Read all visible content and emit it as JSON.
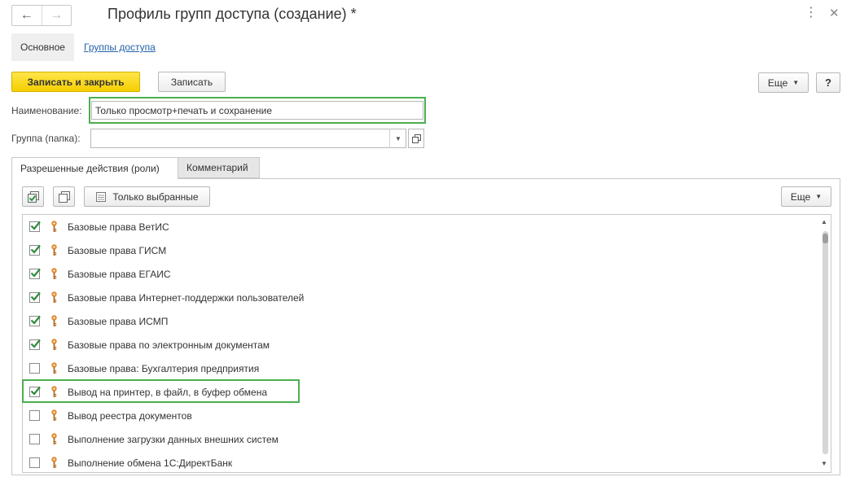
{
  "window": {
    "title": "Профиль групп доступа (создание) *"
  },
  "section_tabs": [
    {
      "label": "Основное"
    },
    {
      "label": "Группы доступа"
    }
  ],
  "toolbar": {
    "save_close_label": "Записать и закрыть",
    "save_label": "Записать",
    "more_label": "Еще",
    "help_label": "?"
  },
  "fields": {
    "name_label": "Наименование:",
    "name_value": "Только просмотр+печать и сохранение",
    "group_label": "Группа (папка):",
    "group_value": ""
  },
  "tabs": [
    {
      "label": "Разрешенные действия (роли)"
    },
    {
      "label": "Комментарий"
    }
  ],
  "roles_toolbar": {
    "only_selected_label": "Только выбранные",
    "more_label": "Еще"
  },
  "roles": [
    {
      "label": "Базовые права ВетИС",
      "checked": true
    },
    {
      "label": "Базовые права ГИСМ",
      "checked": true
    },
    {
      "label": "Базовые права ЕГАИС",
      "checked": true
    },
    {
      "label": "Базовые права Интернет-поддержки пользователей",
      "checked": true
    },
    {
      "label": "Базовые права ИСМП",
      "checked": true
    },
    {
      "label": "Базовые права по электронным документам",
      "checked": true
    },
    {
      "label": "Базовые права: Бухгалтерия предприятия",
      "checked": false
    },
    {
      "label": "Вывод на принтер, в файл, в буфер обмена",
      "checked": true
    },
    {
      "label": "Вывод реестра документов",
      "checked": false
    },
    {
      "label": "Выполнение загрузки данных внешних систем",
      "checked": false
    },
    {
      "label": "Выполнение обмена 1С:ДиректБанк",
      "checked": false
    }
  ],
  "colors": {
    "primary_button": "#f5cf00",
    "highlight_frame": "#4caf50",
    "link": "#2262a8",
    "check": "#2e8b3a",
    "key_icon": "#e08a2e"
  }
}
